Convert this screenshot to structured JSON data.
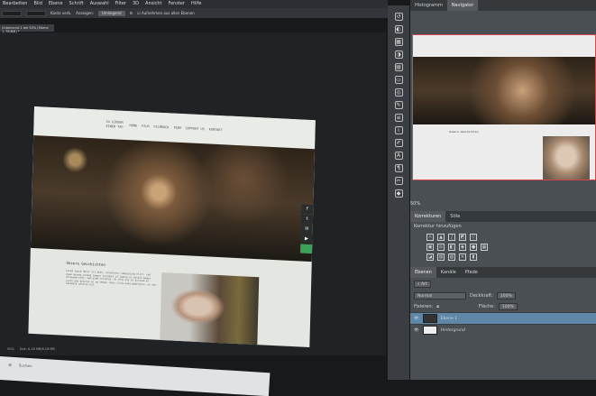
{
  "menu": [
    "Bearbeiten",
    "Bild",
    "Ebene",
    "Schrift",
    "Auswahl",
    "Filter",
    "3D",
    "Ansicht",
    "Fenster",
    "Hilfe"
  ],
  "options": {
    "refine_label": "Kante verb.",
    "sample_label": "Anzeigen:",
    "sample_value": "Umliegend",
    "checkbox_label": "Aufnehmen aus allen Ebenen"
  },
  "doc_tab": "Unbenannt-1 bei 50% (Ebene 1, RGB/8) *",
  "website": {
    "logo": [
      "GA GIDDER",
      "EINEN TAG"
    ],
    "nav": [
      "HOME",
      "FILM",
      "FILMBUCH",
      "TEAM",
      "SUPPORT US",
      "KONTAKT"
    ],
    "section_title": "Unsere Geschichten",
    "body": "Lorem ipsum dolor sit amet, consetetur sadipscing elitr, sed diam nonumy eirmod tempor invidunt ut labore et dolore magna aliquyam erat, sed diam voluptua. At vero eos et accusam et justo duo dolores et ea rebum. Stet clita kasd gubergren, no sea takimata sanctus est.",
    "social": [
      "f",
      "t",
      "✉",
      "▶",
      ""
    ]
  },
  "panel": {
    "tabs": [
      "Histogramm",
      "Navigator"
    ],
    "zoom": "50%",
    "adjust_tabs": [
      "Korrekturen",
      "Stile"
    ],
    "adjust_title": "Korrektur hinzufügen",
    "layer_tabs": [
      "Ebenen",
      "Kanäle",
      "Pfade"
    ],
    "filter": "Art",
    "blend": "Normal",
    "opacity_label": "Deckkraft:",
    "opacity": "100%",
    "lock_label": "Fixieren:",
    "fill_label": "Fläche:",
    "fill": "100%",
    "layers": [
      {
        "name": "Ebene 1",
        "selected": true
      },
      {
        "name": "Hintergrund",
        "selected": false
      }
    ]
  },
  "status": {
    "zoom": "50%",
    "doc": "Dok: 6,18 MB/6,18 MB"
  },
  "taskbar": {
    "search": "Suchen"
  }
}
